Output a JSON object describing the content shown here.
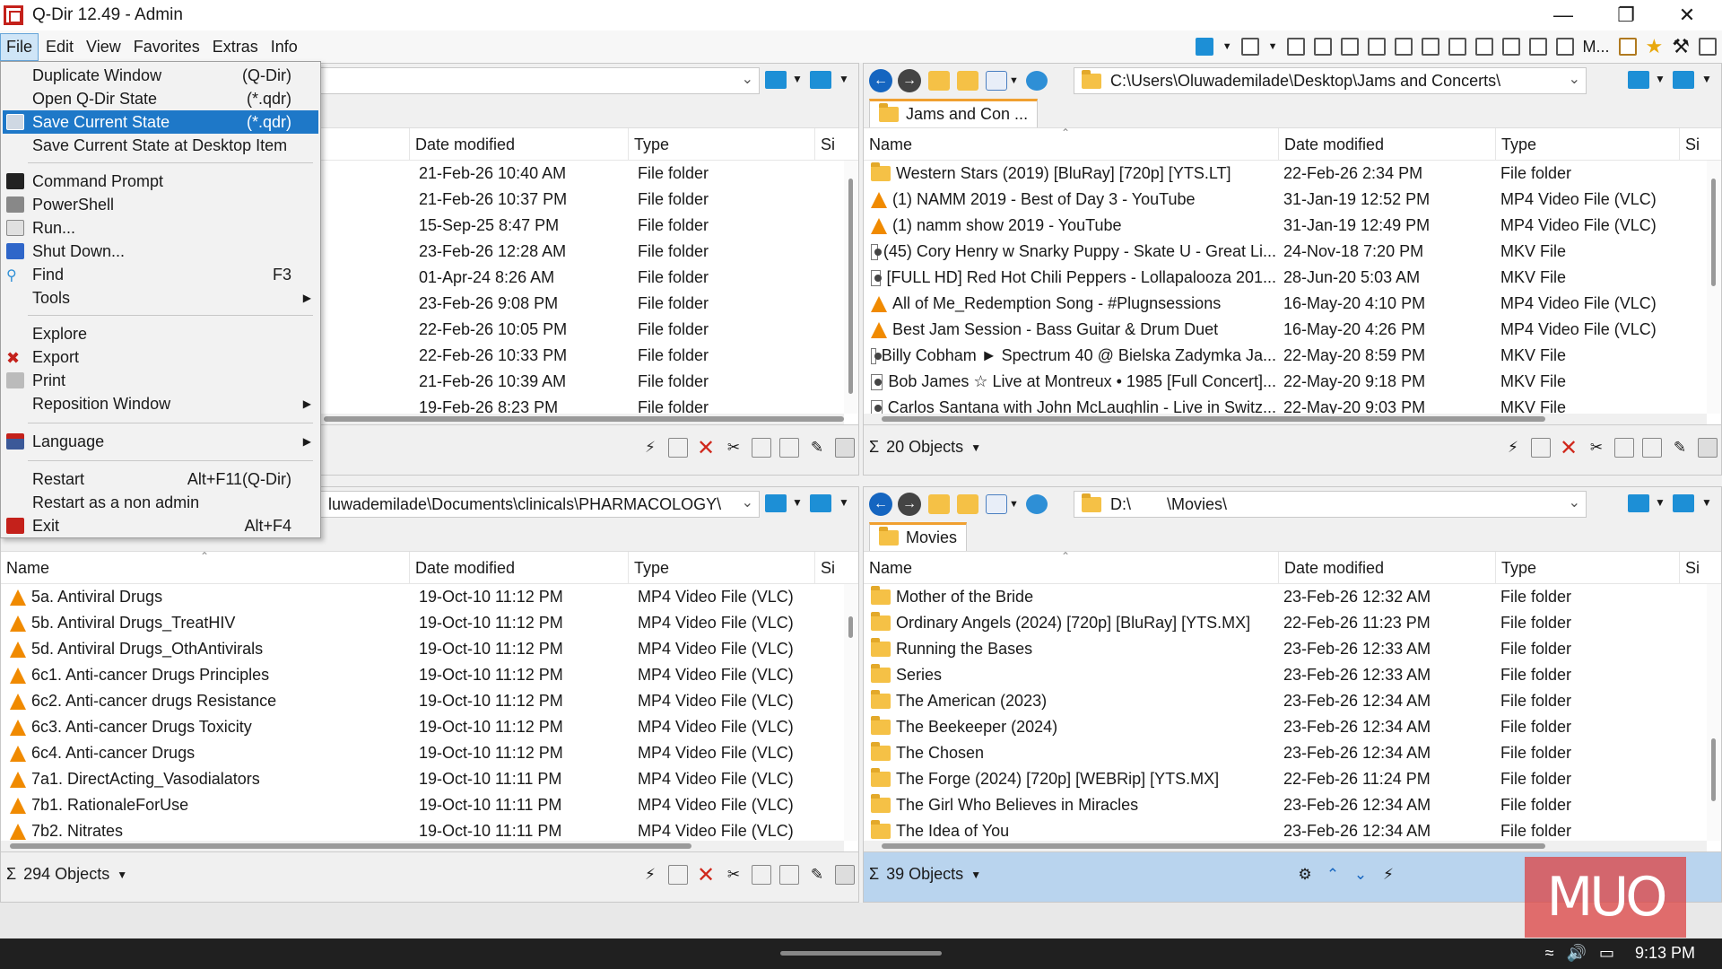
{
  "window": {
    "title": "Q-Dir 12.49 - Admin"
  },
  "menubar": {
    "items": [
      "File",
      "Edit",
      "View",
      "Favorites",
      "Extras",
      "Info"
    ],
    "active": "File"
  },
  "file_menu": {
    "items": [
      {
        "label": "Duplicate Window",
        "shortcut": "(Q-Dir)"
      },
      {
        "label": "Open Q-Dir State",
        "shortcut": "(*.qdr)"
      },
      {
        "label": "Save Current State",
        "shortcut": "(*.qdr)"
      },
      {
        "label": "Save Current State at Desktop Item",
        "shortcut": ""
      },
      {
        "label": "Command Prompt",
        "shortcut": ""
      },
      {
        "label": "PowerShell",
        "shortcut": ""
      },
      {
        "label": "Run...",
        "shortcut": ""
      },
      {
        "label": "Shut Down...",
        "shortcut": ""
      },
      {
        "label": "Find",
        "shortcut": "F3"
      },
      {
        "label": "Tools",
        "shortcut": ""
      },
      {
        "label": "Explore",
        "shortcut": ""
      },
      {
        "label": "Export",
        "shortcut": ""
      },
      {
        "label": "Print",
        "shortcut": ""
      },
      {
        "label": "Reposition Window",
        "shortcut": ""
      },
      {
        "label": "Language",
        "shortcut": ""
      },
      {
        "label": "Restart",
        "shortcut": "Alt+F11(Q-Dir)"
      },
      {
        "label": "Restart as a non admin",
        "shortcut": ""
      },
      {
        "label": "Exit",
        "shortcut": "Alt+F4"
      }
    ]
  },
  "columns": {
    "name": "Name",
    "date": "Date modified",
    "type": "Type",
    "size": "Si"
  },
  "pane_tl": {
    "rows": [
      {
        "date": "21-Feb-26 10:40 AM",
        "type": "File folder"
      },
      {
        "date": "21-Feb-26 10:37 PM",
        "type": "File folder"
      },
      {
        "date": "15-Sep-25 8:47 PM",
        "type": "File folder"
      },
      {
        "date": "23-Feb-26 12:28 AM",
        "type": "File folder"
      },
      {
        "date": "01-Apr-24 8:26 AM",
        "type": "File folder"
      },
      {
        "date": "23-Feb-26 9:08 PM",
        "type": "File folder"
      },
      {
        "date": "22-Feb-26 10:05 PM",
        "type": "File folder"
      },
      {
        "date": "22-Feb-26 10:33 PM",
        "type": "File folder"
      },
      {
        "date": "21-Feb-26 10:39 AM",
        "type": "File folder"
      },
      {
        "date": "19-Feb-26 8:23 PM",
        "type": "File folder"
      }
    ]
  },
  "pane_tr": {
    "address": "C:\\Users\\Oluwademilade\\Desktop\\Jams and Concerts\\",
    "tab": "Jams and Con ...",
    "count": "20 Objects",
    "rows": [
      {
        "icon": "folder",
        "name": "Western Stars (2019) [BluRay] [720p] [YTS.LT]",
        "date": "22-Feb-26 2:34 PM",
        "type": "File folder"
      },
      {
        "icon": "vlc",
        "name": "(1) NAMM 2019 - Best of Day 3 - YouTube",
        "date": "31-Jan-19 12:52 PM",
        "type": "MP4 Video File (VLC)"
      },
      {
        "icon": "vlc",
        "name": "(1) namm show 2019 - YouTube",
        "date": "31-Jan-19 12:49 PM",
        "type": "MP4 Video File (VLC)"
      },
      {
        "icon": "mkv",
        "name": "(45) Cory Henry w Snarky Puppy - Skate U - Great Li...",
        "date": "24-Nov-18 7:20 PM",
        "type": "MKV File"
      },
      {
        "icon": "mkv",
        "name": "[FULL HD] Red Hot Chili Peppers - Lollapalooza 201...",
        "date": "28-Jun-20 5:03 AM",
        "type": "MKV File"
      },
      {
        "icon": "vlc",
        "name": "All of Me_Redemption Song - #Plugnsessions",
        "date": "16-May-20 4:10 PM",
        "type": "MP4 Video File (VLC)"
      },
      {
        "icon": "vlc",
        "name": "Best Jam Session - Bass Guitar & Drum Duet",
        "date": "16-May-20 4:26 PM",
        "type": "MP4 Video File (VLC)"
      },
      {
        "icon": "mkv",
        "name": "Billy Cobham ► Spectrum 40 @ Bielska Zadymka Ja...",
        "date": "22-May-20 8:59 PM",
        "type": "MKV File"
      },
      {
        "icon": "mkv",
        "name": "Bob James ☆ Live at Montreux • 1985 [Full Concert]...",
        "date": "22-May-20 9:18 PM",
        "type": "MKV File"
      },
      {
        "icon": "mkv",
        "name": "Carlos Santana with John McLaughlin - Live in Switz...",
        "date": "22-May-20 9:03 PM",
        "type": "MKV File"
      }
    ]
  },
  "pane_bl": {
    "address": "luwademilade\\Documents\\clinicals\\PHARMACOLOGY\\",
    "count": "294 Objects",
    "rows": [
      {
        "name": "5a.  Antiviral Drugs",
        "date": "19-Oct-10 11:12 PM",
        "type": "MP4 Video File (VLC)"
      },
      {
        "name": "5b.  Antiviral Drugs_TreatHIV",
        "date": "19-Oct-10 11:12 PM",
        "type": "MP4 Video File (VLC)"
      },
      {
        "name": "5d.  Antiviral Drugs_OthAntivirals",
        "date": "19-Oct-10 11:12 PM",
        "type": "MP4 Video File (VLC)"
      },
      {
        "name": "6c1.  Anti-cancer Drugs Principles",
        "date": "19-Oct-10 11:12 PM",
        "type": "MP4 Video File (VLC)"
      },
      {
        "name": "6c2.  Anti-cancer drugs Resistance",
        "date": "19-Oct-10 11:12 PM",
        "type": "MP4 Video File (VLC)"
      },
      {
        "name": "6c3.  Anti-cancer Drugs Toxicity",
        "date": "19-Oct-10 11:12 PM",
        "type": "MP4 Video File (VLC)"
      },
      {
        "name": "6c4.  Anti-cancer Drugs",
        "date": "19-Oct-10 11:12 PM",
        "type": "MP4 Video File (VLC)"
      },
      {
        "name": "7a1.  DirectActing_Vasodialators",
        "date": "19-Oct-10 11:11 PM",
        "type": "MP4 Video File (VLC)"
      },
      {
        "name": "7b1.  RationaleForUse",
        "date": "19-Oct-10 11:11 PM",
        "type": "MP4 Video File (VLC)"
      },
      {
        "name": "7b2.  Nitrates",
        "date": "19-Oct-10 11:11 PM",
        "type": "MP4 Video File (VLC)"
      }
    ]
  },
  "pane_br": {
    "address": "D:\\        \\Movies\\",
    "tab": "Movies",
    "count": "39 Objects",
    "rows": [
      {
        "name": "Mother of the Bride",
        "date": "23-Feb-26 12:32 AM",
        "type": "File folder"
      },
      {
        "name": "Ordinary Angels (2024) [720p] [BluRay] [YTS.MX]",
        "date": "22-Feb-26 11:23 PM",
        "type": "File folder"
      },
      {
        "name": "Running the Bases",
        "date": "23-Feb-26 12:33 AM",
        "type": "File folder"
      },
      {
        "name": "Series",
        "date": "23-Feb-26 12:33 AM",
        "type": "File folder"
      },
      {
        "name": "The American (2023)",
        "date": "23-Feb-26 12:34 AM",
        "type": "File folder"
      },
      {
        "name": "The Beekeeper (2024)",
        "date": "23-Feb-26 12:34 AM",
        "type": "File folder"
      },
      {
        "name": "The Chosen",
        "date": "23-Feb-26 12:34 AM",
        "type": "File folder"
      },
      {
        "name": "The Forge (2024) [720p] [WEBRip] [YTS.MX]",
        "date": "22-Feb-26 11:24 PM",
        "type": "File folder"
      },
      {
        "name": "The Girl Who Believes in Miracles",
        "date": "23-Feb-26 12:34 AM",
        "type": "File folder"
      },
      {
        "name": "The Idea of You",
        "date": "23-Feb-26 12:34 AM",
        "type": "File folder"
      }
    ]
  },
  "toolbar": {
    "view_label": "M..."
  },
  "taskbar": {
    "time": "9:13 PM"
  },
  "watermark": {
    "text": "MUO"
  },
  "colors": {
    "accent": "#1e78c8",
    "active_status": "#b9d4ee",
    "vlc": "#f08a00",
    "folder": "#f5c146",
    "close_red": "#d0281c"
  }
}
